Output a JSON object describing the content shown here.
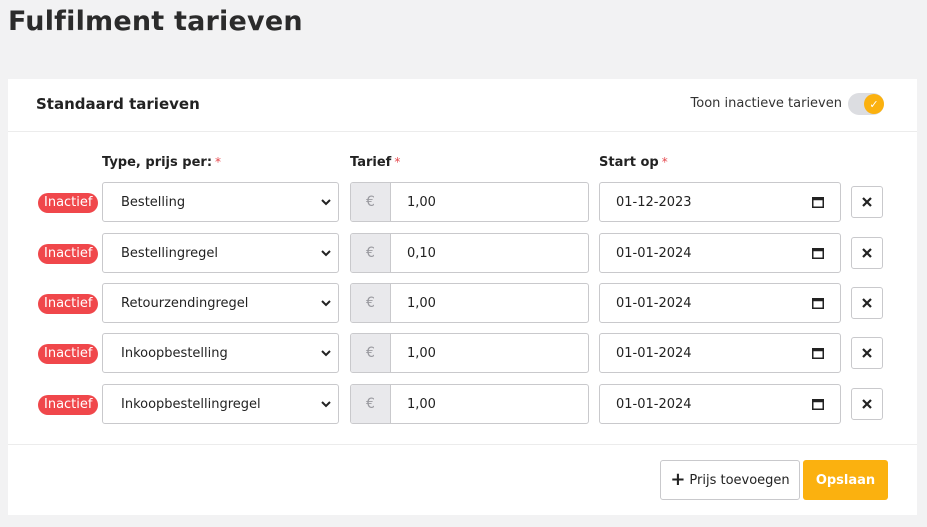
{
  "page": {
    "title": "Fulfilment tarieven"
  },
  "card": {
    "title": "Standaard tarieven",
    "toggle": {
      "label": "Toon inactieve tarieven",
      "checked": true,
      "color": "#fbb10f"
    }
  },
  "columns": {
    "type": "Type, prijs per:",
    "rate": "Tarief",
    "start": "Start op",
    "required_mark": "*"
  },
  "currency_symbol": "€",
  "rows": [
    {
      "status": "Inactief",
      "type": "Bestelling",
      "rate": "1,00",
      "start": "01-12-2023"
    },
    {
      "status": "Inactief",
      "type": "Bestellingregel",
      "rate": "0,10",
      "start": "01-01-2024"
    },
    {
      "status": "Inactief",
      "type": "Retourzendingregel",
      "rate": "1,00",
      "start": "01-01-2024"
    },
    {
      "status": "Inactief",
      "type": "Inkoopbestelling",
      "rate": "1,00",
      "start": "01-01-2024"
    },
    {
      "status": "Inactief",
      "type": "Inkoopbestellingregel",
      "rate": "1,00",
      "start": "01-01-2024"
    }
  ],
  "footer": {
    "add_button": "Prijs toevoegen",
    "save_button": "Opslaan"
  },
  "colors": {
    "accent": "#fbb10f",
    "inactive_badge": "#f0474b"
  },
  "icons": {
    "delete": "close-icon",
    "select": "chevron-down-icon",
    "date": "calendar-icon",
    "add": "plus-icon",
    "toggle": "check-icon"
  }
}
